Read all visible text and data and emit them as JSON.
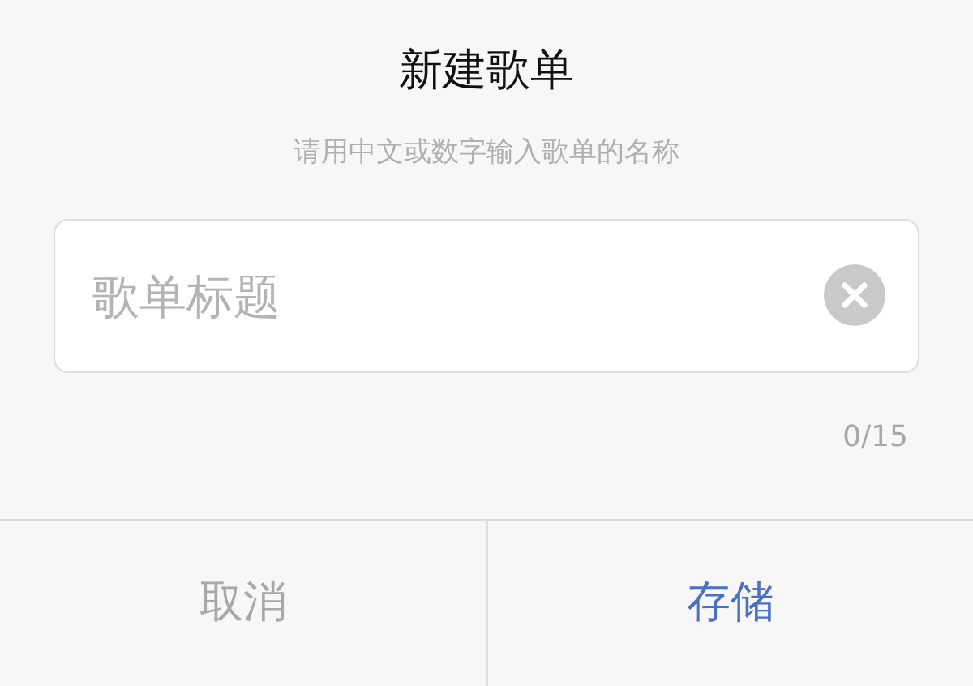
{
  "dialog": {
    "title": "新建歌单",
    "hint": "请用中文或数字输入歌单的名称"
  },
  "field": {
    "placeholder": "歌单标题"
  },
  "counter": "0/15",
  "buttons": [
    {
      "label": "取消",
      "kind": "cancel"
    },
    {
      "label": "存储",
      "kind": "confirm"
    }
  ]
}
